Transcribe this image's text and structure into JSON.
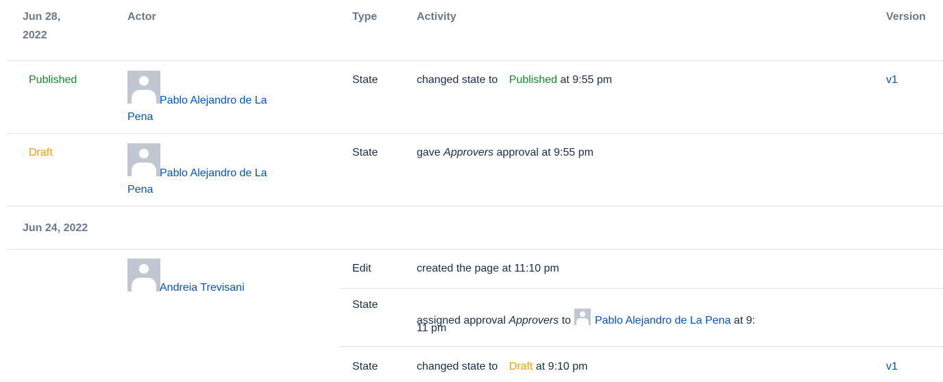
{
  "header": {
    "date_line1": "Jun 28,",
    "date_line2": "2022",
    "actor": "Actor",
    "type": "Type",
    "activity": "Activity",
    "version": "Version"
  },
  "group2_date": "Jun 24, 2022",
  "rows": [
    {
      "status": "Published",
      "actor_line1": "Pablo Alejandro de La",
      "actor_line2": "Pena",
      "type": "State",
      "activity_prefix": "changed state to",
      "activity_state": "Published",
      "activity_suffix": "at 9:55 pm",
      "version": "v1"
    },
    {
      "status": "Draft",
      "actor_line1": "Pablo Alejandro de La",
      "actor_line2": "Pena",
      "type": "State",
      "activity_prefix": "gave",
      "activity_em": "Approvers",
      "activity_suffix": "approval at 9:55 pm"
    },
    {
      "actor": "Andreia Trevisani",
      "sub": [
        {
          "type": "Edit",
          "activity": "created the page at 11:10 pm"
        },
        {
          "type": "State",
          "activity_prefix": "assigned approval",
          "activity_em": "Approvers",
          "activity_to": "to",
          "activity_user": "Pablo Alejandro de La Pena",
          "activity_suffix_1": "at 9:",
          "activity_suffix_2": "11 pm"
        },
        {
          "type": "State",
          "activity_prefix": "changed state to",
          "activity_state": "Draft",
          "activity_suffix": "at 9:10 pm",
          "version": "v1"
        }
      ]
    }
  ],
  "colors": {
    "header_text": "#6b778c",
    "link": "#0052cc",
    "published": "#14892c",
    "draft": "#f6a000",
    "divider": "#dfe1e6",
    "avatar_bg": "#c1c7d0"
  },
  "icons": {
    "avatar": "default-user-avatar-icon"
  }
}
